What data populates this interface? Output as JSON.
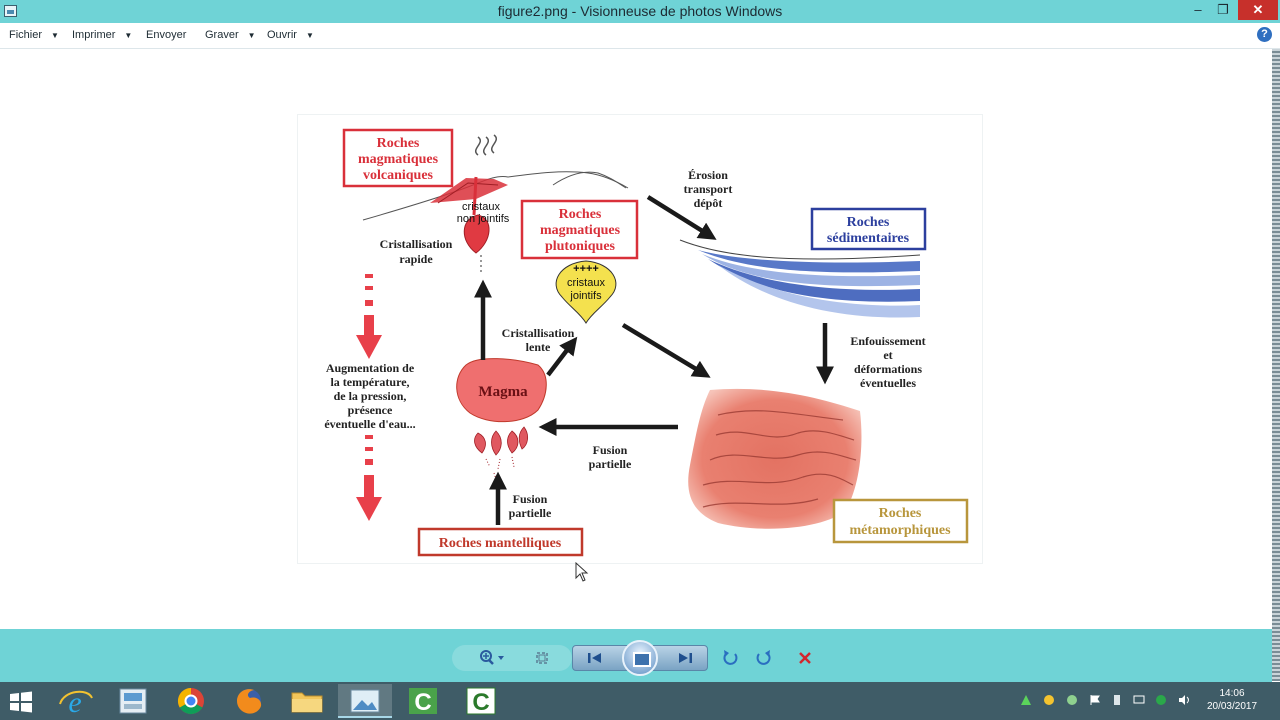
{
  "window": {
    "title": "figure2.png - Visionneuse de photos Windows",
    "controls": {
      "minimize": "–",
      "maximize": "❐",
      "close": "✕"
    }
  },
  "menu": {
    "items": [
      {
        "label": "Fichier",
        "has_dropdown": true
      },
      {
        "label": "Imprimer",
        "has_dropdown": true
      },
      {
        "label": "Envoyer",
        "has_dropdown": false
      },
      {
        "label": "Graver",
        "has_dropdown": true
      },
      {
        "label": "Ouvrir",
        "has_dropdown": true
      }
    ],
    "help_label": "?"
  },
  "figure": {
    "boxes": {
      "volcaniques": [
        "Roches",
        "magmatiques",
        "volcaniques"
      ],
      "plutoniques": [
        "Roches",
        "magmatiques",
        "plutoniques"
      ],
      "sedimentaires": [
        "Roches",
        "sédimentaires"
      ],
      "metamorphiques": [
        "Roches",
        "métamorphiques"
      ],
      "mantelliques": "Roches mantelliques"
    },
    "labels": {
      "cristaux_non_jointifs": [
        "cristaux",
        "non jointifs"
      ],
      "cristallisation_rapide": [
        "Cristallisation",
        "rapide"
      ],
      "cristaux_jointifs_marks": "++++",
      "cristaux_jointifs": [
        "cristaux",
        "jointifs"
      ],
      "erosion": [
        "Érosion",
        "transport",
        "dépôt"
      ],
      "cristallisation_lente": [
        "Cristallisation",
        "lente"
      ],
      "magma": "Magma",
      "augmentation": [
        "Augmentation de",
        "la température,",
        "de la pression,",
        "présence",
        "éventuelle d'eau..."
      ],
      "enfouissement": [
        "Enfouissement",
        "et",
        "déformations",
        "éventuelles"
      ],
      "fusion_partielle_right": [
        "Fusion",
        "partielle"
      ],
      "fusion_partielle_bottom": [
        "Fusion",
        "partielle"
      ]
    },
    "colors": {
      "volcanic_red": "#d9303a",
      "sedimentary_blue": "#2c3f9e",
      "metamorphic_gold": "#b8963c",
      "mantle_red": "#c0392b",
      "magma_pink": "#ef6f6f",
      "arrow_black": "#1a1a1a",
      "arrow_red": "#e8404a"
    }
  },
  "controls": {
    "zoom": "zoom-icon",
    "fit": "actual-size-icon",
    "previous": "previous-icon",
    "slideshow": "slideshow-icon",
    "next": "next-icon",
    "rotate_left": "rotate-left-icon",
    "rotate_right": "rotate-right-icon",
    "delete": "delete-icon"
  },
  "taskbar": {
    "clock": {
      "time": "14:06",
      "date": "20/03/2017"
    }
  }
}
